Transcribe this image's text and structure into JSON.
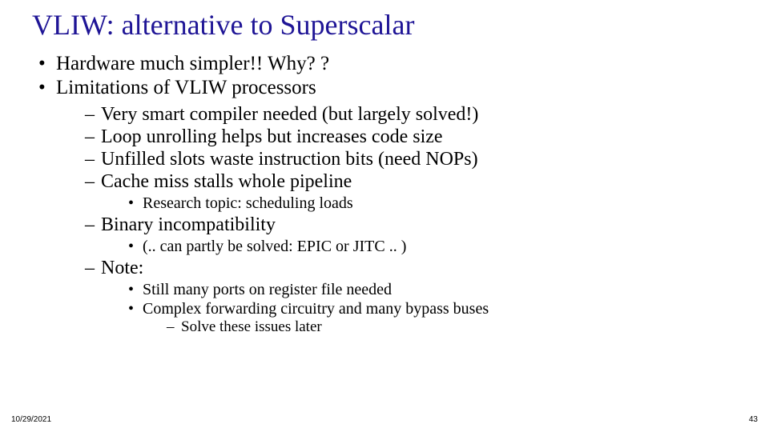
{
  "title": "VLIW: alternative to Superscalar",
  "bullets": {
    "b1": "Hardware much simpler!! Why? ?",
    "b2": "Limitations of VLIW processors",
    "s1": "Very smart compiler needed (but largely solved!)",
    "s2": "Loop unrolling helps but increases code size",
    "s3": "Unfilled slots waste instruction bits (need NOPs)",
    "s4": "Cache miss stalls whole pipeline",
    "ss1": "Research topic: scheduling loads",
    "s5": "Binary incompatibility",
    "ss2": "(.. can partly be solved: EPIC or JITC .. )",
    "s6": "Note:",
    "ss3": "Still many ports on register file needed",
    "ss4": "Complex forwarding circuitry and many bypass buses",
    "sss1": "Solve these issues later"
  },
  "footer": {
    "date": "10/29/2021",
    "page": "43",
    "center": ""
  }
}
